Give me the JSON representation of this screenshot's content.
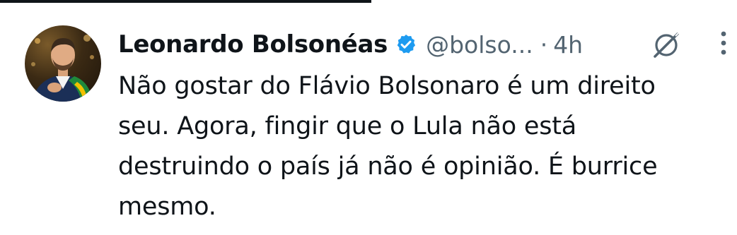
{
  "tweet": {
    "author_name": "Leonardo Bolsonéas",
    "handle": "@bolso...",
    "separator": "·",
    "time": "4h",
    "text_lines": [
      "Não gostar do Flávio Bolsonaro é um direito",
      "seu. Agora, fingir que o Lula não está",
      "destruindo o país já não é opinião. É burrice",
      "mesmo."
    ],
    "verified_color": "#1d9bf0",
    "icons": {
      "verified": "verified-badge-icon",
      "grok": "grok-icon",
      "more": "more-options-icon"
    }
  }
}
